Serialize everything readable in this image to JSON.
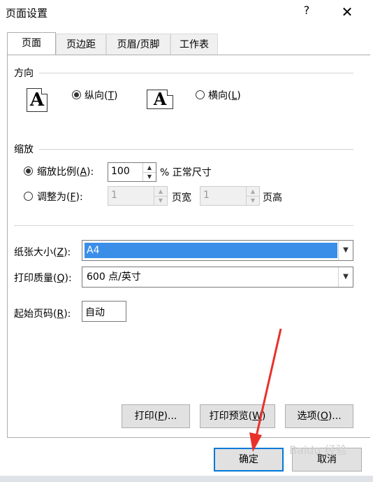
{
  "window": {
    "title": "页面设置",
    "help": "?",
    "close": "✕"
  },
  "tabs": [
    {
      "label": "页面",
      "active": true
    },
    {
      "label": "页边距",
      "active": false
    },
    {
      "label": "页眉/页脚",
      "active": false
    },
    {
      "label": "工作表",
      "active": false
    }
  ],
  "orientation": {
    "heading": "方向",
    "portrait": {
      "label": "纵向(",
      "key": "T",
      "tail": ")",
      "checked": true
    },
    "landscape": {
      "label": "横向(",
      "key": "L",
      "tail": ")",
      "checked": false
    },
    "icon_glyph": "A"
  },
  "scaling": {
    "heading": "缩放",
    "adjust": {
      "label": "缩放比例(",
      "key": "A",
      "tail": "):",
      "checked": true,
      "value": "100",
      "suffix": "% 正常尺寸"
    },
    "fit": {
      "label": "调整为(",
      "key": "F",
      "tail": "):",
      "checked": false,
      "wide": "1",
      "wide_label": "页宽",
      "tall": "1",
      "tall_label": "页高"
    }
  },
  "paper_size": {
    "label": "纸张大小(",
    "key": "Z",
    "tail": "):",
    "value": "A4"
  },
  "print_quality": {
    "label": "打印质量(",
    "key": "Q",
    "tail": "):",
    "value": "600 点/英寸"
  },
  "first_page": {
    "label": "起始页码(",
    "key": "R",
    "tail": "):",
    "value": "自动"
  },
  "buttons": {
    "print": {
      "label": "打印(",
      "key": "P",
      "tail": ")..."
    },
    "preview": {
      "label": "打印预览(",
      "key": "W",
      "tail": ")"
    },
    "options": {
      "label": "选项(",
      "key": "O",
      "tail": ")..."
    },
    "ok": "确定",
    "cancel": "取消"
  },
  "colors": {
    "accent": "#0078d7",
    "selection": "#3b8ee8",
    "annotation_arrow": "#e8312a"
  }
}
